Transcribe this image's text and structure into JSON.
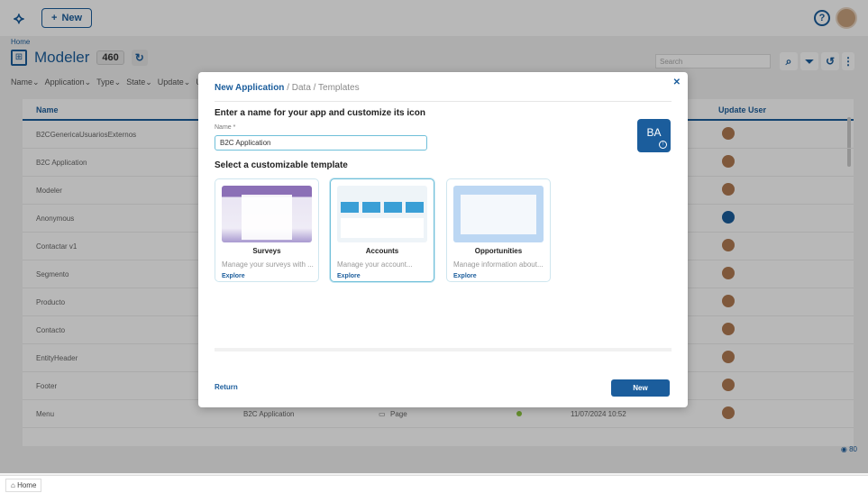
{
  "topbar": {
    "new_label": "New"
  },
  "breadcrumb": "Home",
  "page": {
    "title": "Modeler",
    "count": "460"
  },
  "search": {
    "placeholder": "Search"
  },
  "filters": [
    "Name",
    "Application",
    "Type",
    "State",
    "Update",
    "U"
  ],
  "table": {
    "headers": {
      "name": "Name",
      "update_user": "Update User"
    },
    "rows": [
      {
        "name": "B2CGenericaUsuariosExternos",
        "user_icon": "user-avatar"
      },
      {
        "name": "B2C Application",
        "user_icon": "user-avatar"
      },
      {
        "name": "Modeler",
        "user_icon": "user-avatar"
      },
      {
        "name": "Anonymous",
        "user_icon": "anonymous-avatar"
      },
      {
        "name": "Contactar v1",
        "user_icon": "user-avatar"
      },
      {
        "name": "Segmento",
        "user_icon": "user-avatar"
      },
      {
        "name": "Producto",
        "user_icon": "user-avatar"
      },
      {
        "name": "Contacto",
        "user_icon": "user-avatar"
      },
      {
        "name": "EntityHeader",
        "user_icon": "user-avatar"
      },
      {
        "name": "Footer",
        "user_icon": "user-avatar"
      },
      {
        "name": "Menu",
        "user_icon": "user-avatar",
        "application": "B2C Application",
        "type": "Page",
        "date": "11/07/2024 10:52"
      }
    ]
  },
  "views_count": "80",
  "footer": {
    "home_tab": "Home"
  },
  "modal": {
    "breadcrumb_active": "New Application",
    "breadcrumb_rest": " / Data / Templates",
    "heading": "Enter a name for your app and customize its icon",
    "name_label": "Name *",
    "name_value": "B2C Application",
    "icon_initials": "BA",
    "templates_heading": "Select a customizable template",
    "templates": [
      {
        "title": "Surveys",
        "desc": "Manage your surveys with ...",
        "link": "Explore"
      },
      {
        "title": "Accounts",
        "desc": "Manage your account...",
        "link": "Explore"
      },
      {
        "title": "Opportunities",
        "desc": "Manage information about...",
        "link": "Explore"
      }
    ],
    "return_label": "Return",
    "new_label": "New"
  },
  "colors": {
    "accent": "#1b5d9c",
    "selected_border": "#6fbfd9"
  }
}
